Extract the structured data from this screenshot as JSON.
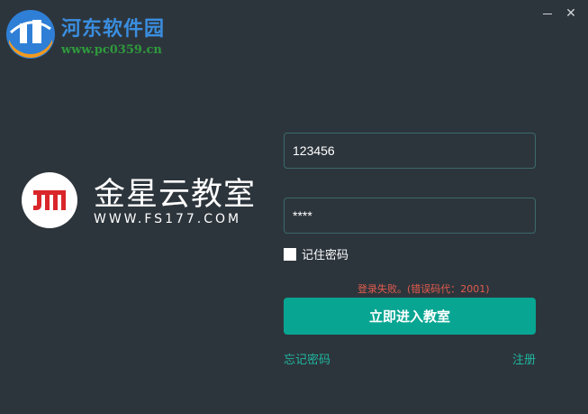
{
  "watermark": {
    "title": "河东软件园",
    "url": "www.pc0359.cn"
  },
  "window": {
    "close_glyph": "✕"
  },
  "brand": {
    "name": "金星云教室",
    "url": "WWW.FS177.COM",
    "logo_text": "JM"
  },
  "login": {
    "username_value": "123456",
    "password_value": "****",
    "remember_label": "记住密码",
    "remember_checked": false,
    "error_message": "登录失败。(错误码代：2001)",
    "submit_label": "立即进入教室",
    "forgot_label": "忘记密码",
    "register_label": "注册"
  },
  "colors": {
    "background": "#2d353c",
    "accent": "#08a592",
    "link": "#1fb69f",
    "error": "#e25c4e",
    "brand_red": "#d9262b"
  },
  "icons": [
    "minimize-icon",
    "close-icon",
    "watermark-logo-icon",
    "brand-logo-icon"
  ]
}
